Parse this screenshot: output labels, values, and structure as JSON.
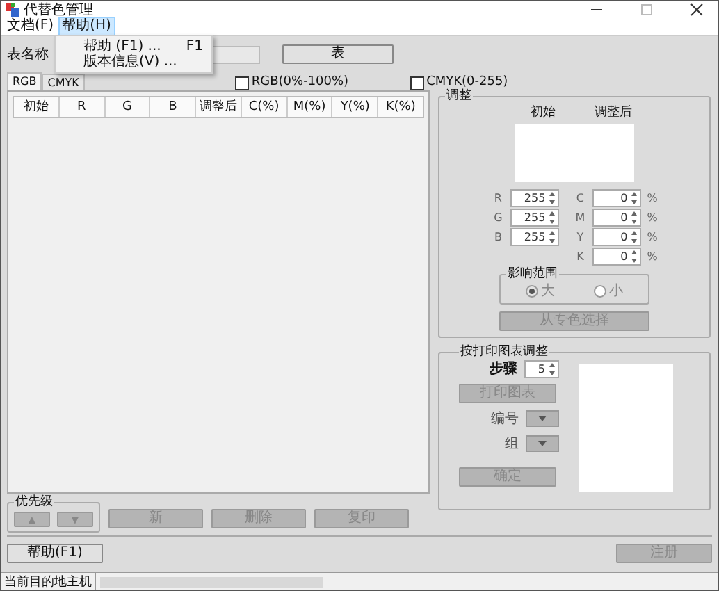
{
  "window": {
    "title": "代替色管理"
  },
  "menu": [
    {
      "label": "文档(F)",
      "selected": false
    },
    {
      "label": "帮助(H)",
      "selected": true
    }
  ],
  "dropdown": [
    {
      "label": "帮助 (F1) ...",
      "shortcut": "F1"
    },
    {
      "label": "版本信息(V) ..."
    }
  ],
  "table_name": {
    "label": "表名称",
    "button": {
      "label": "表",
      "disabled": false
    }
  },
  "tabs": [
    {
      "label": "RGB",
      "selected": true
    },
    {
      "label": "CMYK",
      "selected": false
    }
  ],
  "options": [
    {
      "label": "RGB(0%-100%)",
      "checked": false
    },
    {
      "label": "CMYK(0-255)",
      "checked": false
    }
  ],
  "table": {
    "columns": [
      "初始",
      "R",
      "G",
      "B",
      "调整后",
      "C(%)",
      "M(%)",
      "Y(%)",
      "K(%)"
    ]
  },
  "adjust": {
    "title": "调整",
    "preview_labels": [
      "初始",
      "调整后"
    ],
    "rgb_fields": [
      {
        "label": "R",
        "value": "255"
      },
      {
        "label": "G",
        "value": "255"
      },
      {
        "label": "B",
        "value": "255"
      }
    ],
    "cmyk_fields": [
      {
        "label": "C",
        "value": "0",
        "unit": "%"
      },
      {
        "label": "M",
        "value": "0",
        "unit": "%"
      },
      {
        "label": "Y",
        "value": "0",
        "unit": "%"
      },
      {
        "label": "K",
        "value": "0",
        "unit": "%"
      }
    ],
    "scope": {
      "title": "影响范围",
      "disabled": true,
      "options": [
        {
          "label": "大",
          "selected": true
        },
        {
          "label": "小",
          "selected": false
        }
      ]
    },
    "spot_button": {
      "label": "从专色选择",
      "disabled": true
    }
  },
  "chart_adjust": {
    "title": "按打印图表调整",
    "step": {
      "label": "步骤",
      "value": "5"
    },
    "print_button": {
      "label": "打印图表",
      "disabled": true
    },
    "number": {
      "label": "编号"
    },
    "group": {
      "label": "组"
    },
    "ok_button": {
      "label": "确定",
      "disabled": true
    }
  },
  "priority": {
    "title": "优先级",
    "buttons": [
      {
        "label": "▲",
        "disabled": true
      },
      {
        "label": "▼",
        "disabled": true
      }
    ]
  },
  "row_buttons": [
    {
      "label": "新",
      "disabled": true
    },
    {
      "label": "删除",
      "disabled": true
    },
    {
      "label": "复印",
      "disabled": true
    }
  ],
  "help_button": {
    "label": "帮助(F1)",
    "disabled": false
  },
  "register_button": {
    "label": "注册",
    "disabled": true
  },
  "status_bar": {
    "label": "当前目的地主机"
  }
}
